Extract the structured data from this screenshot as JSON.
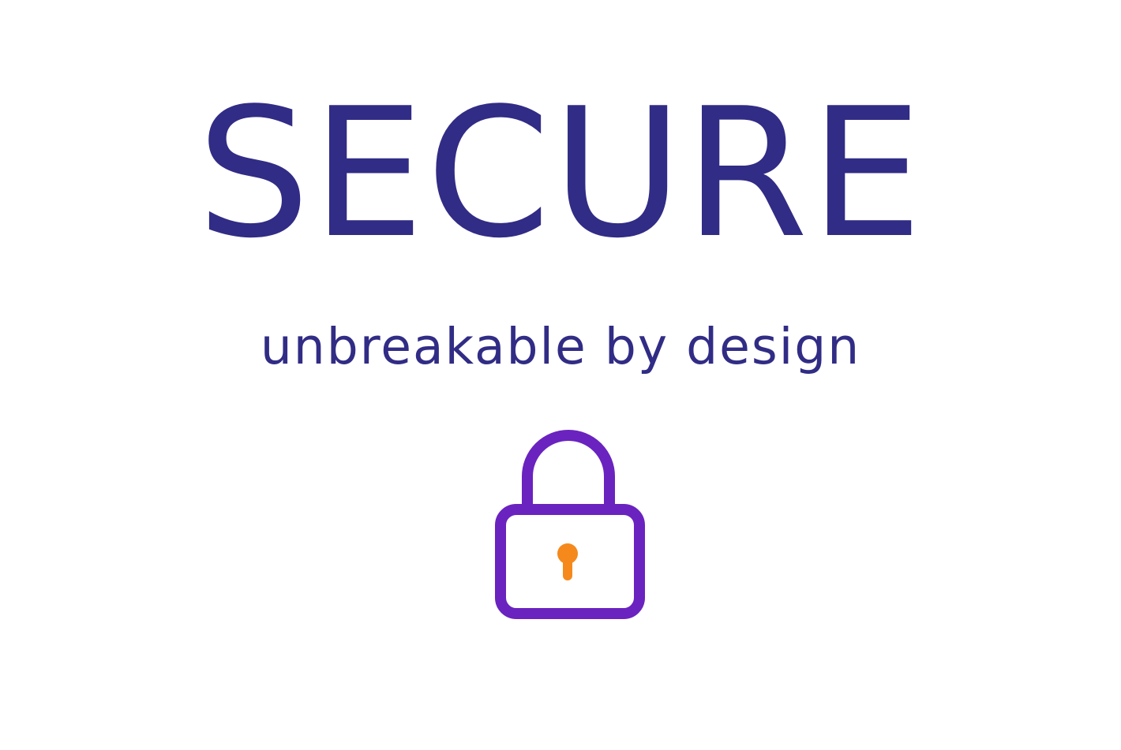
{
  "hero": {
    "headline": "SECURE",
    "tagline": "unbreakable by design"
  },
  "icon": {
    "name": "padlock-icon",
    "shackle_and_body_color": "#6a23bf",
    "keyhole_color": "#f5891c"
  },
  "colors": {
    "text": "#312c85",
    "background": "#ffffff"
  }
}
